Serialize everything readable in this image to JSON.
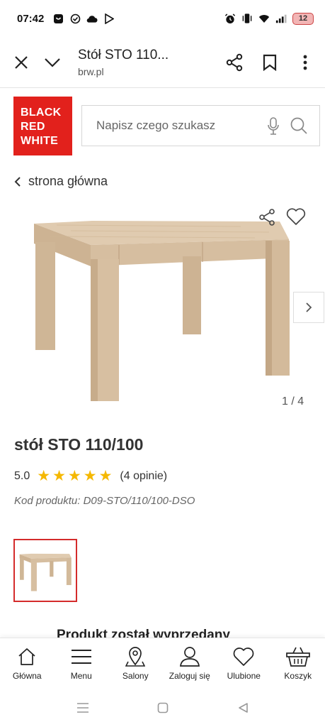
{
  "status_bar": {
    "time": "07:42",
    "battery": "12"
  },
  "browser": {
    "title": "Stół STO 110...",
    "url": "brw.pl"
  },
  "logo": {
    "line1": "BLACK",
    "line2": "RED",
    "line3": "WHITE"
  },
  "search": {
    "placeholder": "Napisz czego szukasz"
  },
  "breadcrumb": {
    "label": "strona główna"
  },
  "gallery": {
    "counter": "1 / 4"
  },
  "product": {
    "title": "stół STO 110/100",
    "rating": "5.0",
    "stars": 5,
    "reviews": "(4 opinie)",
    "code": "Kod produktu: D09-STO/110/100-DSO"
  },
  "notice": {
    "text": "Produkt został wyprzedany"
  },
  "bottom_nav": {
    "items": [
      {
        "label": "Główna",
        "icon": "home-icon"
      },
      {
        "label": "Menu",
        "icon": "menu-icon"
      },
      {
        "label": "Salony",
        "icon": "map-pin-icon"
      },
      {
        "label": "Zaloguj się",
        "icon": "user-icon"
      },
      {
        "label": "Ulubione",
        "icon": "heart-icon"
      },
      {
        "label": "Koszyk",
        "icon": "basket-icon"
      }
    ]
  },
  "colors": {
    "brand_red": "#e2211c",
    "star": "#f5b800",
    "thumb_border": "#d42b2b",
    "wood": "#d9c2a5"
  }
}
